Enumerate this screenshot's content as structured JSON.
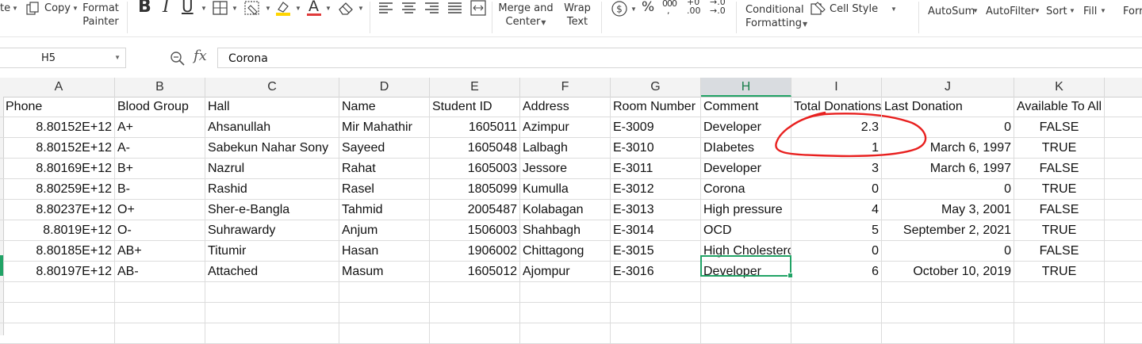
{
  "ribbon": {
    "paste_label": "te",
    "copy_label": "Copy",
    "format_painter": [
      "Format",
      "Painter"
    ],
    "font_color_bar": "#e03a3a",
    "highlight_bar": "#ffd500",
    "merge_center": [
      "Merge and",
      "Center"
    ],
    "wrap_text": [
      "Wrap",
      "Text"
    ],
    "number_fmt": {
      "comma": "000",
      "inc_decimal_top": "+0",
      "inc_decimal_bottom": ".00",
      "dec_decimal_top": "→.0",
      "dec_decimal_bottom": "→.0"
    },
    "conditional_formatting": [
      "Conditional",
      "Formatting"
    ],
    "cell_style": "Cell Style",
    "autosum": "AutoSum",
    "autofilter": "AutoFilter",
    "sort": "Sort",
    "fill": "Fill",
    "format_cut": "Forr"
  },
  "formula_bar": {
    "name_box": "H5",
    "fx": "fx",
    "value": "Corona"
  },
  "columns": [
    "A",
    "B",
    "C",
    "D",
    "E",
    "F",
    "G",
    "H",
    "I",
    "J",
    "K"
  ],
  "active_column": "H",
  "headers": [
    "Phone",
    "Blood Group",
    "Hall",
    "Name",
    "Student ID",
    "Address",
    "Room Number",
    "Comment",
    "Total Donations",
    "Last Donation",
    "Available To All"
  ],
  "rows": [
    [
      "8.80152E+12",
      "A+",
      "Ahsanullah",
      "Mir Mahathir",
      "1605011",
      "Azimpur",
      "E-3009",
      "Developer",
      "2.3",
      "0",
      "FALSE"
    ],
    [
      "8.80152E+12",
      "A-",
      "Sabekun Nahar Sony",
      "Sayeed",
      "1605048",
      "Lalbagh",
      "E-3010",
      "DIabetes",
      "1",
      "March 6, 1997",
      "TRUE"
    ],
    [
      "8.80169E+12",
      "B+",
      "Nazrul",
      "Rahat",
      "1605003",
      "Jessore",
      "E-3011",
      "Developer",
      "3",
      "March 6, 1997",
      "FALSE"
    ],
    [
      "8.80259E+12",
      "B-",
      "Rashid",
      "Rasel",
      "1805099",
      "Kumulla",
      "E-3012",
      "Corona",
      "0",
      "0",
      "TRUE"
    ],
    [
      "8.80237E+12",
      "O+",
      "Sher-e-Bangla",
      "Tahmid",
      "2005487",
      "Kolabagan",
      "E-3013",
      "High pressure",
      "4",
      "May 3, 2001",
      "FALSE"
    ],
    [
      "8.8019E+12",
      "O-",
      "Suhrawardy",
      "Anjum",
      "1506003",
      "Shahbagh",
      "E-3014",
      "OCD",
      "5",
      "September 2, 2021",
      "TRUE"
    ],
    [
      "8.80185E+12",
      "AB+",
      "Titumir",
      "Hasan",
      "1906002",
      "Chittagong",
      "E-3015",
      "High Cholesterol",
      "0",
      "0",
      "FALSE"
    ],
    [
      "8.80197E+12",
      "AB-",
      "Attached",
      "Masum",
      "1605012",
      "Ajompur",
      "E-3016",
      "Developer",
      "6",
      "October 10, 2019",
      "TRUE"
    ]
  ],
  "annotation_color": "#e8201f",
  "selection_color": "#21a366"
}
